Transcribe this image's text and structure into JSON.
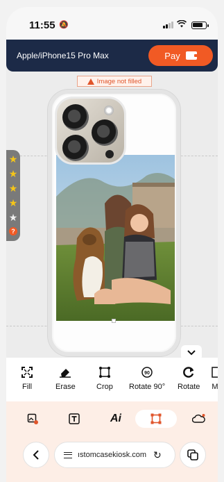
{
  "status": {
    "time": "11:55"
  },
  "header": {
    "model": "Apple/iPhone15 Pro Max",
    "pay_label": "Pay"
  },
  "editor": {
    "warning": "Image not filled"
  },
  "rating": {
    "value": 4,
    "max": 5
  },
  "tools": [
    {
      "label": "Fill",
      "icon": "fill-icon"
    },
    {
      "label": "Erase",
      "icon": "eraser-icon"
    },
    {
      "label": "Crop",
      "icon": "crop-icon"
    },
    {
      "label": "Rotate 90°",
      "icon": "rotate-90-icon"
    },
    {
      "label": "Rotate",
      "icon": "rotate-icon"
    },
    {
      "label": "M",
      "icon": "more-icon"
    }
  ],
  "tabs": [
    {
      "name": "image-tab",
      "icon": "image-icon"
    },
    {
      "name": "text-tab",
      "icon": "text-icon"
    },
    {
      "name": "ai-tab",
      "icon": "ai-icon",
      "text": "Ai"
    },
    {
      "name": "frame-tab",
      "icon": "frame-icon",
      "active": true
    },
    {
      "name": "cloud-tab",
      "icon": "cloud-icon"
    }
  ],
  "browser": {
    "url": "ıstomcasekiosk.com"
  },
  "colors": {
    "accent": "#f15a24",
    "header_bg": "#1c2a47",
    "tab_bg": "#fdeee6"
  }
}
